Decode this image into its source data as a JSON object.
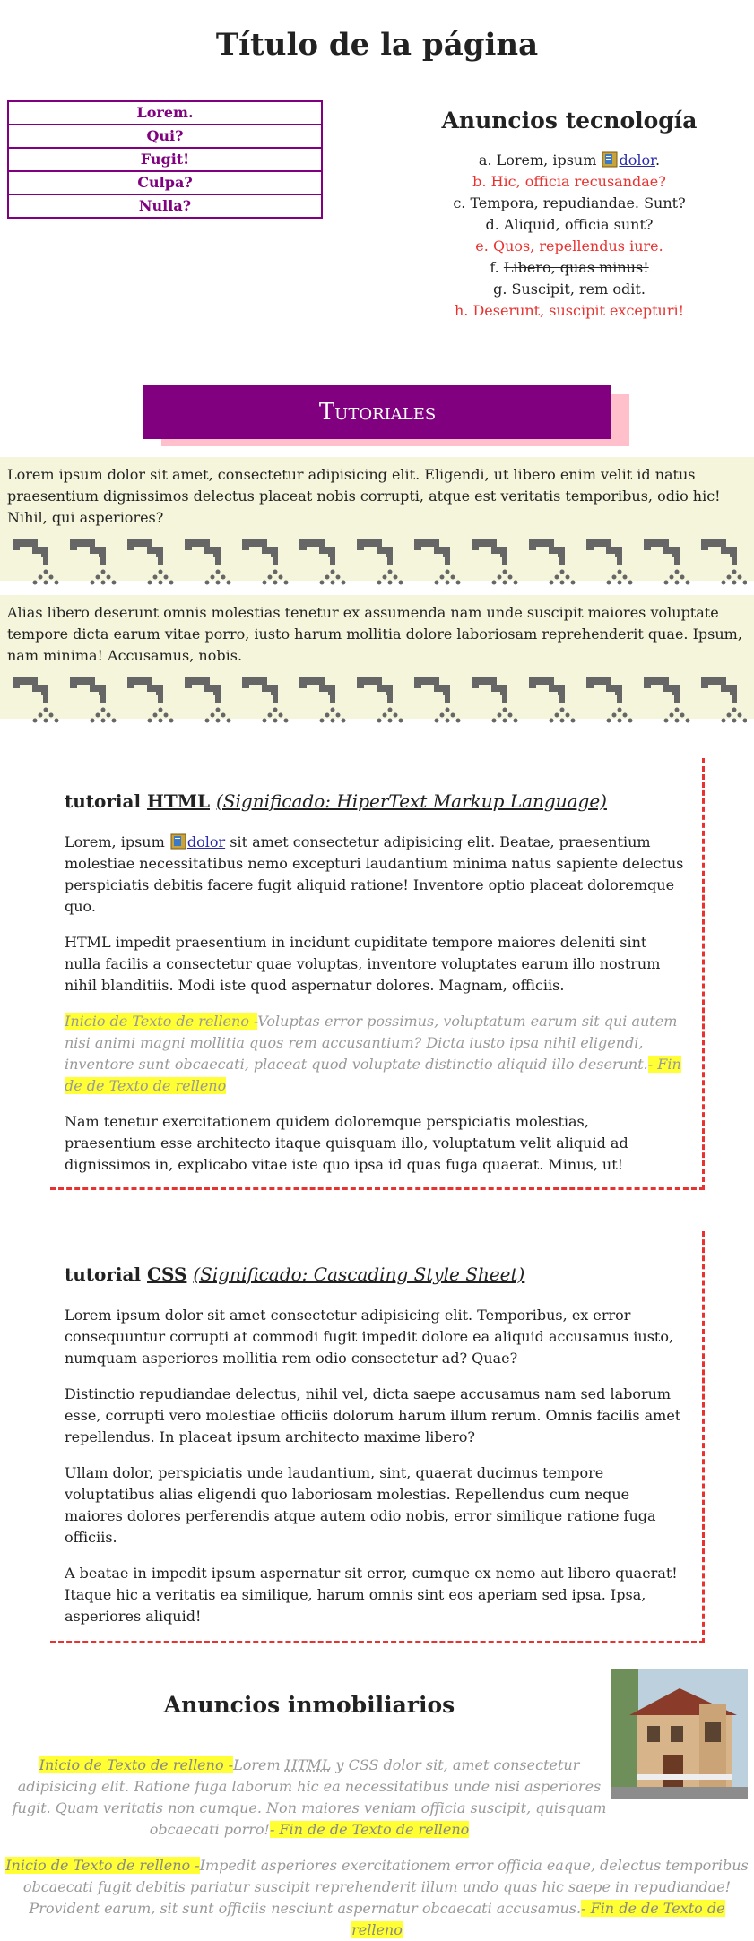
{
  "page_title": "Título de la página",
  "nav": [
    "Lorem.",
    "Qui?",
    "Fugit!",
    "Culpa?",
    "Nulla?"
  ],
  "tech": {
    "title": "Anuncios tecnología",
    "items": [
      {
        "marker": "a.",
        "text": "Lorem, ipsum",
        "link": "dolor",
        "after": ".",
        "style": "normal"
      },
      {
        "marker": "b.",
        "text": "Hic, officia recusandae?",
        "style": "red"
      },
      {
        "marker": "c.",
        "text": "Tempora, repudiandae. Sunt?",
        "style": "strike"
      },
      {
        "marker": "d.",
        "text": "Aliquid, officia sunt?",
        "style": "normal"
      },
      {
        "marker": "e.",
        "text": "Quos, repellendus iure.",
        "style": "red"
      },
      {
        "marker": "f.",
        "text": "Libero, quas minus!",
        "style": "strike"
      },
      {
        "marker": "g.",
        "text": "Suscipit, rem odit.",
        "style": "normal"
      },
      {
        "marker": "h.",
        "text": "Deserunt, suscipit excepturi!",
        "style": "red"
      }
    ]
  },
  "banner": "Tutoriales",
  "beige1": "Lorem ipsum dolor sit amet, consectetur adipisicing elit. Eligendi, ut libero enim velit id natus praesentium dignissimos delectus placeat nobis corrupti, atque est veritatis temporibus, odio hic! Nihil, qui asperiores?",
  "beige2": "Alias libero deserunt omnis molestias tenetur ex assumenda nam unde suscipit maiores voluptate tempore dicta earum vitae porro, iusto harum mollitia dolore laboriosam reprehenderit quae. Ipsum, nam minima! Accusamus, nobis.",
  "html_tutorial": {
    "prefix": "tutorial",
    "abbr": "HTML",
    "meaning": "(Significado: HiperText Markup Language)",
    "p1_start": "Lorem, ipsum",
    "p1_link": "dolor",
    "p1_rest": "sit amet consectetur adipisicing elit. Beatae, praesentium molestiae necessitatibus nemo excepturi laudantium minima natus sapiente delectus perspiciatis debitis facere fugit aliquid ratione! Inventore optio placeat doloremque quo.",
    "p2": "HTML impedit praesentium in incidunt cupiditate tempore maiores deleniti sint nulla facilis a consectetur quae voluptas, inventore voluptates earum illo nostrum nihil blanditiis. Modi iste quod aspernatur dolores. Magnam, officiis.",
    "p3_start": "Inicio de Texto de relleno -",
    "p3_body": "Voluptas error possimus, voluptatum earum sit qui autem nisi animi magni mollitia quos rem accusantium? Dicta iusto ipsa nihil eligendi, inventore sunt obcaecati, placeat quod voluptate distinctio aliquid illo deserunt.",
    "p3_end": "- Fin de de Texto de relleno",
    "p4": "Nam tenetur exercitationem quidem doloremque perspiciatis molestias, praesentium esse architecto itaque quisquam illo, voluptatum velit aliquid ad dignissimos in, explicabo vitae iste quo ipsa id quas fuga quaerat. Minus, ut!"
  },
  "css_tutorial": {
    "prefix": "tutorial",
    "abbr": "CSS",
    "meaning": "(Significado: Cascading Style Sheet)",
    "p1": "Lorem ipsum dolor sit amet consectetur adipisicing elit. Temporibus, ex error consequuntur corrupti at commodi fugit impedit dolore ea aliquid accusamus iusto, numquam asperiores mollitia rem odio consectetur ad? Quae?",
    "p2": "Distinctio repudiandae delectus, nihil vel, dicta saepe accusamus nam sed laborum esse, corrupti vero molestiae officiis dolorum harum illum rerum. Omnis facilis amet repellendus. In placeat ipsum architecto maxime libero?",
    "p3": "Ullam dolor, perspiciatis unde laudantium, sint, quaerat ducimus tempore voluptatibus alias eligendi quo laboriosam molestias. Repellendus cum neque maiores dolores perferendis atque autem odio nobis, error similique ratione fuga officiis.",
    "p4": "A beatae in impedit ipsum aspernatur sit error, cumque ex nemo aut libero quaerat! Itaque hic a veritatis ea similique, harum omnis sint eos aperiam sed ipsa. Ipsa, asperiores aliquid!"
  },
  "inmob": {
    "title": "Anuncios inmobiliarios",
    "p1_start": "Inicio de Texto de relleno -",
    "p1_a": "Lorem",
    "p1_html": "HTML",
    "p1_b": "y CSS dolor sit, amet consectetur adipisicing elit. Ratione fuga laborum hic ea necessitatibus unde nisi asperiores fugit. Quam veritatis non cumque. Non maiores veniam officia suscipit, quisquam obcaecati porro!",
    "p1_end": "- Fin de de Texto de relleno",
    "p2_start": "Inicio de Texto de relleno -",
    "p2_body": "Impedit asperiores exercitationem error officia eaque, delectus temporibus obcaecati fugit debitis pariatur suscipit reprehenderit illum undo quas hic saepe in repudiandae! Provident earum, sit sunt officiis nesciunt aspernatur obcaecati accusamus.",
    "p2_end": "- Fin de de Texto de relleno"
  },
  "colors": {
    "accent": "#800080",
    "shadow": "#ffc0cb",
    "red": "#e8322f",
    "beige": "#f5f5dc",
    "highlight": "#ffff33"
  }
}
